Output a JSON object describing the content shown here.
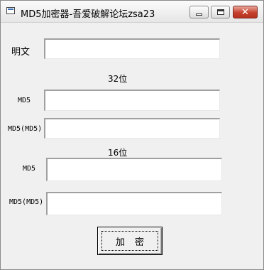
{
  "window": {
    "title": "MD5加密器-吾爱破解论坛zsa23"
  },
  "controls": {
    "minimize": "minimize",
    "maximize": "maximize",
    "close": "close",
    "close_glyph": "✕"
  },
  "form": {
    "plaintext_label": "明文",
    "plaintext_value": "",
    "section_32_label": "32位",
    "md5_32_label": "MD5",
    "md5_32_value": "",
    "md5md5_32_label": "MD5(MD5)",
    "md5md5_32_value": "",
    "section_16_label": "16位",
    "md5_16_label": "MD5",
    "md5_16_value": "",
    "md5md5_16_label": "MD5(MD5)",
    "md5md5_16_value": "",
    "encrypt_button": "加密"
  },
  "icons": {
    "app": "window-app-icon",
    "minimize": "minimize-icon",
    "maximize": "maximize-icon",
    "close": "close-icon"
  }
}
